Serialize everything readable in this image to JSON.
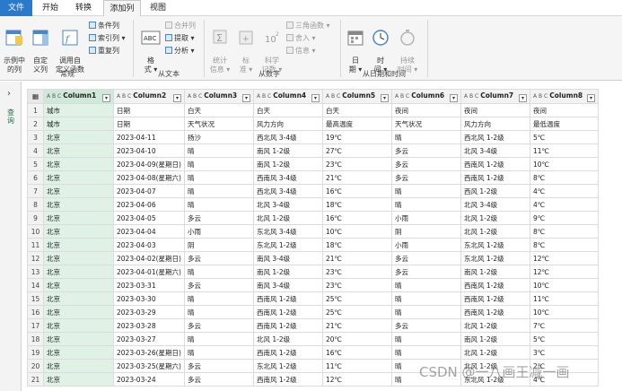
{
  "tabs": [
    "文件",
    "开始",
    "转换",
    "添加列",
    "视图"
  ],
  "ribbon": {
    "general": {
      "group_label": "常规",
      "example_column": "示例中\n的列",
      "custom_column": "自定\n义列",
      "invoke_custom_function": "调用自\n定义函数",
      "conditional_column": "条件列",
      "index_column": "索引列",
      "duplicate_column": "重复列"
    },
    "from_text": {
      "group_label": "从文本",
      "format": "格\n式",
      "merge_columns": "合并列",
      "extract": "提取",
      "parse": "分析"
    },
    "from_number": {
      "group_label": "从数字",
      "statistics": "统计\n信息",
      "standard": "标\n准",
      "scientific": "科学\n记数",
      "trigonometry": "三角函数",
      "rounding": "舍入",
      "information": "信息"
    },
    "from_datetime": {
      "group_label": "从日期和时间",
      "date": "日\n期",
      "time": "时\n间",
      "duration": "持续\n时间"
    }
  },
  "left_pane": {
    "label": "查询"
  },
  "grid": {
    "column_type": "A B C",
    "columns": [
      "Column1",
      "Column2",
      "Column3",
      "Column4",
      "Column5",
      "Column6",
      "Column7",
      "Column8"
    ],
    "rows": [
      [
        "1",
        "城市",
        "日期",
        "白天",
        "白天",
        "白天",
        "夜间",
        "夜间",
        "夜间"
      ],
      [
        "2",
        "城市",
        "日期",
        "天气状况",
        "风力方向",
        "最高温度",
        "天气状况",
        "风力方向",
        "最低温度"
      ],
      [
        "3",
        "北京",
        "2023-04-11",
        "扬沙",
        "西北风 3-4级",
        "19℃",
        "晴",
        "西北风 1-2级",
        "5℃"
      ],
      [
        "4",
        "北京",
        "2023-04-10",
        "晴",
        "南风 1-2级",
        "27℃",
        "多云",
        "北风 3-4级",
        "11℃"
      ],
      [
        "5",
        "北京",
        "2023-04-09(星期日)",
        "晴",
        "南风 1-2级",
        "23℃",
        "多云",
        "西南风 1-2级",
        "10℃"
      ],
      [
        "6",
        "北京",
        "2023-04-08(星期六)",
        "晴",
        "西南风 3-4级",
        "21℃",
        "多云",
        "西南风 1-2级",
        "8℃"
      ],
      [
        "7",
        "北京",
        "2023-04-07",
        "晴",
        "西北风 3-4级",
        "16℃",
        "晴",
        "西风 1-2级",
        "4℃"
      ],
      [
        "8",
        "北京",
        "2023-04-06",
        "晴",
        "北风 3-4级",
        "18℃",
        "晴",
        "北风 3-4级",
        "4℃"
      ],
      [
        "9",
        "北京",
        "2023-04-05",
        "多云",
        "北风 1-2级",
        "16℃",
        "小雨",
        "北风 1-2级",
        "9℃"
      ],
      [
        "10",
        "北京",
        "2023-04-04",
        "小雨",
        "东北风 3-4级",
        "10℃",
        "阴",
        "北风 1-2级",
        "8℃"
      ],
      [
        "11",
        "北京",
        "2023-04-03",
        "阴",
        "东北风 1-2级",
        "18℃",
        "小雨",
        "东北风 1-2级",
        "8℃"
      ],
      [
        "12",
        "北京",
        "2023-04-02(星期日)",
        "多云",
        "南风 3-4级",
        "21℃",
        "多云",
        "东北风 1-2级",
        "12℃"
      ],
      [
        "13",
        "北京",
        "2023-04-01(星期六)",
        "晴",
        "南风 1-2级",
        "23℃",
        "多云",
        "南风 1-2级",
        "12℃"
      ],
      [
        "14",
        "北京",
        "2023-03-31",
        "多云",
        "南风 3-4级",
        "23℃",
        "晴",
        "西南风 1-2级",
        "10℃"
      ],
      [
        "15",
        "北京",
        "2023-03-30",
        "晴",
        "西南风 1-2级",
        "25℃",
        "晴",
        "西南风 1-2级",
        "11℃"
      ],
      [
        "16",
        "北京",
        "2023-03-29",
        "晴",
        "西南风 1-2级",
        "25℃",
        "晴",
        "西南风 1-2级",
        "10℃"
      ],
      [
        "17",
        "北京",
        "2023-03-28",
        "多云",
        "西南风 1-2级",
        "21℃",
        "多云",
        "北风 1-2级",
        "7℃"
      ],
      [
        "18",
        "北京",
        "2023-03-27",
        "晴",
        "北风 1-2级",
        "20℃",
        "晴",
        "南风 1-2级",
        "5℃"
      ],
      [
        "19",
        "北京",
        "2023-03-26(星期日)",
        "晴",
        "西南风 1-2级",
        "16℃",
        "晴",
        "北风 1-2级",
        "3℃"
      ],
      [
        "20",
        "北京",
        "2023-03-25(星期六)",
        "多云",
        "东北风 1-2级",
        "11℃",
        "晴",
        "北风 1-2级",
        "2℃"
      ],
      [
        "21",
        "北京",
        "2023-03-24",
        "多云",
        "西南风 1-2级",
        "12℃",
        "晴",
        "东北风 1-2级",
        "4℃"
      ]
    ]
  },
  "watermark": "CSDN @一八画王减一画"
}
